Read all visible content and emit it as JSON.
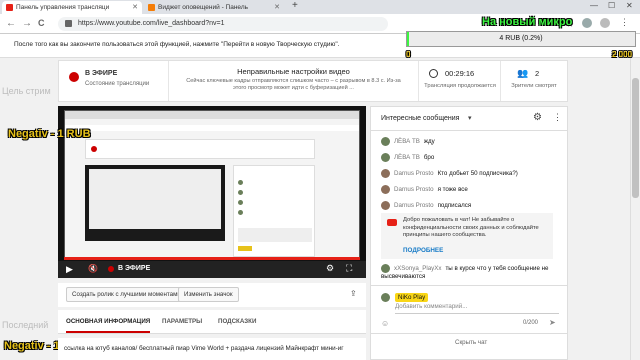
{
  "browser": {
    "tabs": [
      {
        "label": "Панель управления трансляци",
        "active": true,
        "icon": "youtube-icon",
        "color": "#e62117"
      },
      {
        "label": "Виджет оповещений - Панель",
        "active": false,
        "icon": "donationalerts-icon",
        "color": "#f57d07"
      }
    ],
    "new_tab": "+",
    "url": "https://www.youtube.com/live_dashboard?nv=1",
    "nav": {
      "back": "←",
      "forward": "→",
      "reload": "C"
    },
    "window_controls": {
      "minimize": "—",
      "maximize": "☐",
      "close": "✕"
    }
  },
  "notice": "После того как вы закончите пользоваться этой функцией, нажмите \"Перейти в новую Творческую студию\".",
  "status": {
    "live_label": "В ЭФИРЕ",
    "live_sub": "Состояние трансляции",
    "warning_title": "Неправильные настройки видео",
    "warning_text": "Сейчас ключевые кадры отправляются слишком часто – с разрывом в 8.3 с. Из-за этого просмотр может идти с буферизацией ...",
    "duration": "00:29:16",
    "duration_label": "Трансляция продолжается",
    "viewers": "2",
    "viewers_label": "Зрители смотрят"
  },
  "player": {
    "overlay_live": "В ЭФИРЕ",
    "progress_fraction": 1.0
  },
  "chat": {
    "header": "Интересные сообщения",
    "messages": [
      {
        "author": "ЛЁВА ТВ",
        "text": "жду"
      },
      {
        "author": "ЛЁВА ТВ",
        "text": "бро"
      },
      {
        "author": "Darnus Prosto",
        "text": "Кто добьет 50 подписчика?)"
      },
      {
        "author": "Darnus Prosto",
        "text": "я тоже все"
      },
      {
        "author": "Darnus Prosto",
        "text": "подписался"
      }
    ],
    "system_message": "Добро пожаловать в чат! Не забывайте о конфиденциальности своих данных и соблюдайте принципы нашего сообщества.",
    "system_link": "ПОДРОБНЕЕ",
    "last_message": {
      "author": "xXSonya_PlayXx",
      "text": "ты в курсе что у тебя сообщение не высвечиваются"
    },
    "me": "NiKo Play",
    "input_placeholder": "Добавить комментарий...",
    "counter": "0/200",
    "hide_chat": "Скрыть чат"
  },
  "buttons": {
    "best_moments": "Создать ролик с лучшими моментами",
    "change_icon": "Изменить значок"
  },
  "tabs": [
    "ОСНОВНАЯ ИНФОРМАЦИЯ",
    "ПАРАМЕТРЫ",
    "ПОДСКАЗКИ"
  ],
  "stream_title": "ссылка на ютуб каналов/ бесплатный пиар Vime World + раздача лицензий Майнкрафт мини-иг",
  "overlays": {
    "goal_label": "На новый микро",
    "goal_amount": "4 RUB (0.2%)",
    "goal_min": "0",
    "goal_max": "2 000",
    "negativ_1": "Negativ - 1 RUB",
    "negativ_2": "Negativ - 1 RUB",
    "ghost_1": "Цель стрим",
    "ghost_2": "Последний"
  }
}
